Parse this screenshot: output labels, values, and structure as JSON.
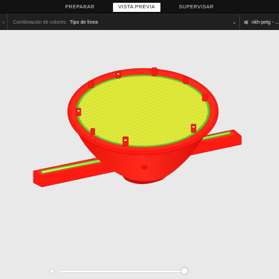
{
  "tabs": {
    "prepare": "PREPARAR",
    "preview": "VISTA PREVIA",
    "monitor": "SUPERVISAR"
  },
  "toolbar": {
    "color_scheme_label": "Combinación de colores:",
    "color_scheme_value": "Tipo de línea",
    "profile_name": "nkh-petg - ..."
  },
  "icons": {
    "collapse": "chevron-left-icon",
    "dropdown": "chevron-down-icon",
    "settings": "sliders-icon",
    "play": "play-icon"
  },
  "colors": {
    "model_red": "#ff1a12",
    "infill_yellow": "#e3f23a",
    "top_green": "#46c322",
    "active_tab_bg": "#ffffff"
  },
  "layer_slider": {
    "position": 1.0
  }
}
